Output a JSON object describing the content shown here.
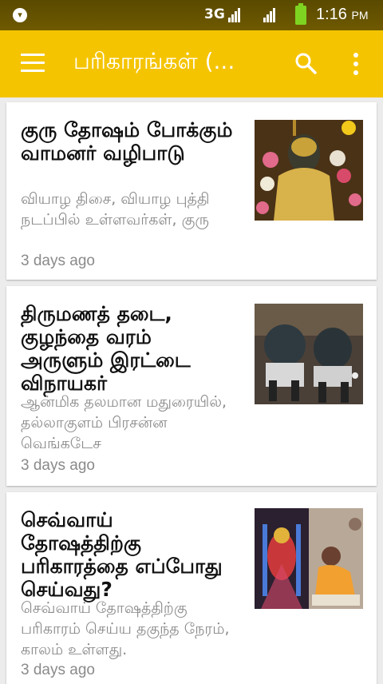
{
  "status_bar": {
    "network_label": "3G",
    "time": "1:16",
    "ampm": "PM"
  },
  "app_bar": {
    "title": "பரிகாரங்கள் (...",
    "icons": [
      "menu-icon",
      "search-icon",
      "more-vert-icon"
    ]
  },
  "articles": [
    {
      "headline": "குரு தோஷம் போக்கும் வாமனர் வழிபாடு",
      "summary": "வியாழ திசை, வியாழ புத்தி நடப்பில் உள்ளவர்கள், குரு",
      "age": "3 days ago"
    },
    {
      "headline": "திருமணத் தடை, குழந்தை வரம் அருளும் இரட்டை விநாயகர்",
      "summary": "ஆன்மிக தலமான மதுரையில், தல்லாகுளம் பிரசன்ன வெங்கடேச",
      "age": "3 days ago"
    },
    {
      "headline": "செவ்வாய் தோஷத்திற்கு பரிகாரத்தை எப்போது செய்வது?",
      "summary": "செவ்வாய் தோஷத்திற்கு பரிகாரம் செய்ய தகுந்த நேரம், காலம் உள்ளது.",
      "age": "3 days ago"
    }
  ],
  "colors": {
    "app_bar": "#f5c400",
    "background": "#ececec",
    "headline": "#111111",
    "meta_text": "#8a8a8a"
  }
}
